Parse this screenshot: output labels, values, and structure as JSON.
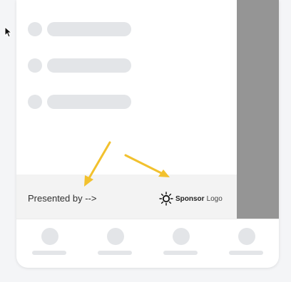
{
  "footer": {
    "presented_by": "Presented by -->",
    "sponsor_bold": "Sponsor",
    "sponsor_light": "Logo"
  },
  "skeleton_list": {
    "row_count": 3
  },
  "bottom_nav": {
    "item_count": 4
  },
  "colors": {
    "skeleton": "#e3e5e8",
    "side_panel": "#959595",
    "arrow": "#f2c12e",
    "footer_bg": "#f3f3f3"
  },
  "icons": {
    "sponsor": "sun-icon",
    "cursor": "mouse-pointer-icon",
    "annotation": "arrow-annotation"
  }
}
